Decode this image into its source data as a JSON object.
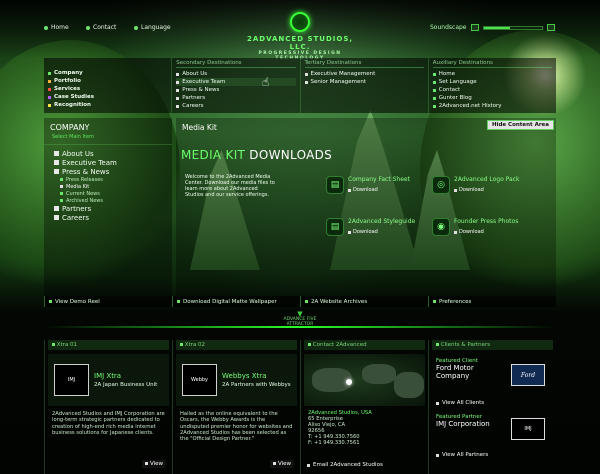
{
  "topnav": {
    "home": "Home",
    "contact": "Contact",
    "language": "Language"
  },
  "logo": {
    "title": "2ADVANCED STUDIOS, LLC.",
    "subtitle": "PROGRESSIVE DESIGN TECHNOLOGY"
  },
  "soundscape": {
    "label": "Soundscape",
    "level": 0.45
  },
  "menu": {
    "primary": [
      {
        "label": "Company",
        "color": "#69e569"
      },
      {
        "label": "Portfolio",
        "color": "#ffb23a"
      },
      {
        "label": "Services",
        "color": "#ff4f3a"
      },
      {
        "label": "Case Studies",
        "color": "#b45cff"
      },
      {
        "label": "Recognition",
        "color": "#ffe04a"
      }
    ],
    "secondary_head": "Secondary Destinations",
    "secondary": [
      "About Us",
      "Executive Team",
      "Press & News",
      "Partners",
      "Careers"
    ],
    "tertiary_head": "Tertiary Destinations",
    "tertiary": [
      "Executive Management",
      "Senior Management"
    ],
    "auxiliary_head": "Auxiliary Destinations",
    "auxiliary": [
      "Home",
      "Set Language",
      "Contact",
      "Gunter Blog",
      "2Advanced.net History"
    ]
  },
  "sidebar": {
    "title": "COMPANY",
    "subtitle": "Select Main Item",
    "items": [
      {
        "label": "About Us",
        "level": 1
      },
      {
        "label": "Executive Team",
        "level": 1
      },
      {
        "label": "Press & News",
        "level": 1
      },
      {
        "label": "Press Releases",
        "level": 2
      },
      {
        "label": "Media Kit",
        "level": 2
      },
      {
        "label": "Current News",
        "level": 2
      },
      {
        "label": "Archived News",
        "level": 2
      },
      {
        "label": "Partners",
        "level": 1
      },
      {
        "label": "Careers",
        "level": 1
      }
    ]
  },
  "main": {
    "title": "Media Kit",
    "hide_button": "Hide Content Area",
    "heading_a": "MEDIA KIT",
    "heading_b": " DOWNLOADS",
    "welcome": "Welcome to the 2Advanced Media Center. Download our media files to learn more about 2Advanced Studios and our service offerings.",
    "downloads": [
      {
        "name": "Company Fact Sheet",
        "link": "Download"
      },
      {
        "name": "2Advanced Logo Pack",
        "link": "Download"
      },
      {
        "name": "2Advanced Styleguide",
        "link": "Download"
      },
      {
        "name": "Founder Press Photos",
        "link": "Download"
      }
    ]
  },
  "strip": [
    "View Demo Reel",
    "Download Digital Matte Wallpaper",
    "2A Website Archives",
    "Preferences"
  ],
  "attractor": {
    "line1": "ADVANCE FIVE",
    "line2": "ATTRACTOR"
  },
  "cards": {
    "xtra1": {
      "head": "Xtra 01",
      "thumb": "IMJ",
      "title": "IMJ Xtra",
      "sub": "2A Japan Business Unit",
      "text": "2Advanced Studios and IMJ Corporation are long-term strategic partners dedicated to creation of high-end rich media internet business solutions for Japanese clients.",
      "view": "View"
    },
    "xtra2": {
      "head": "Xtra 02",
      "thumb": "Webby",
      "title": "Webbys Xtra",
      "sub": "2A Partners with Webbys",
      "text": "Hailed as the online equivalent to the Oscars, the Webby Awards is the undisputed premier honor for websites and 2Advanced Studios has been selected as the \"Official Design Partner.\"",
      "view": "View"
    },
    "contact": {
      "head": "Contact 2Advanced",
      "name": "2Advanced Studios, USA",
      "addr1": "65 Enterprise",
      "addr2": "Aliso Viejo, CA",
      "addr3": "92656",
      "tel": "T: +1 949.330.7560",
      "fax": "F: +1 949.330.7561",
      "email": "Email 2Advanced Studios"
    },
    "clients": {
      "head": "Clients & Partners",
      "feat_client": "Featured Client",
      "client": "Ford Motor Company",
      "client_logo": "Ford",
      "view_clients": "View All Clients",
      "feat_partner": "Featured Partner",
      "partner": "IMJ Corporation",
      "partner_logo": "IMJ",
      "view_partners": "View All Partners"
    }
  }
}
